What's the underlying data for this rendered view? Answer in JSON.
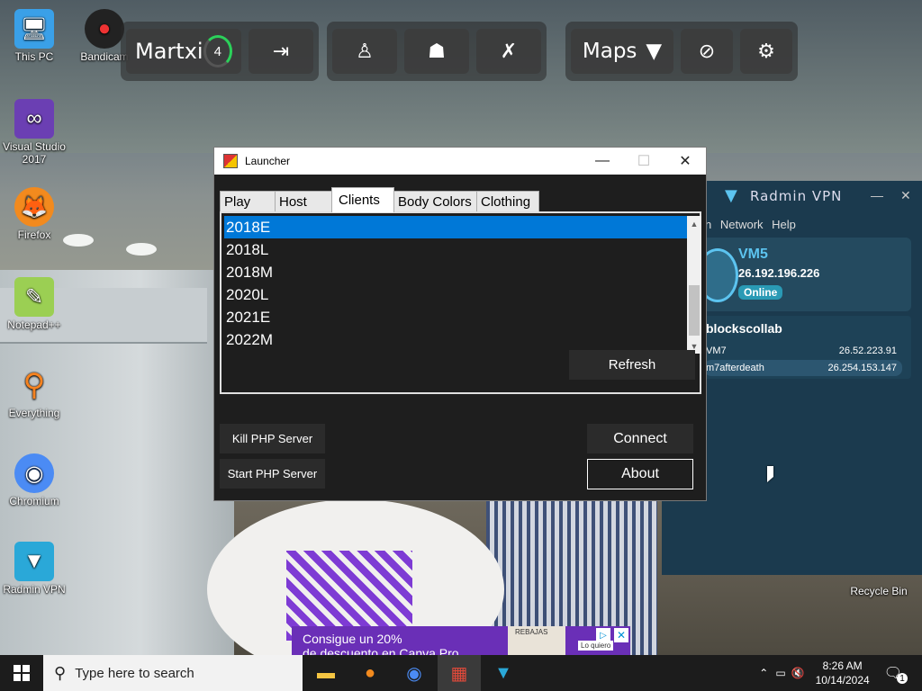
{
  "desktop": {
    "icons": [
      {
        "label": "This PC",
        "icon": "computer-icon"
      },
      {
        "label": "Bandicam",
        "icon": "bandicam-icon"
      },
      {
        "label": "Visual Studio 2017",
        "icon": "visual-studio-icon"
      },
      {
        "label": "Firefox",
        "icon": "firefox-icon"
      },
      {
        "label": "Notepad++",
        "icon": "notepad-plus-icon"
      },
      {
        "label": "Everything",
        "icon": "everything-icon"
      },
      {
        "label": "Chromium",
        "icon": "chromium-icon"
      },
      {
        "label": "Radmin VPN",
        "icon": "radmin-vpn-icon"
      },
      {
        "label": "Recycle Bin",
        "icon": "recycle-bin-icon"
      }
    ]
  },
  "game_toolbar": {
    "username": "Martxi",
    "level": "4",
    "maps_label": "Maps",
    "icons": [
      "logout-icon",
      "character-icon",
      "group-icon",
      "swords-icon",
      "chevron-down-icon",
      "no-timer-icon",
      "gear-icon"
    ]
  },
  "launcher": {
    "title": "Launcher",
    "window_controls": {
      "minimize": "—",
      "maximize": "☐",
      "close": "✕"
    },
    "tabs": [
      "Play",
      "Host",
      "Clients",
      "Body Colors",
      "Clothing"
    ],
    "active_tab": "Clients",
    "clients": [
      "2018E",
      "2018L",
      "2018M",
      "2020L",
      "2021E",
      "2022M"
    ],
    "selected_client": "2018E",
    "refresh_label": "Refresh",
    "kill_php_label": "Kill PHP Server",
    "start_php_label": "Start PHP Server",
    "connect_label": "Connect",
    "about_label": "About"
  },
  "radmin": {
    "brand": "Radmin VPN",
    "menu": "n Network Help",
    "device_name": "VM5",
    "device_ip": "26.192.196.226",
    "device_status": "Online",
    "network_name": "blockscollab",
    "peers": [
      {
        "name": "VM7",
        "ip": "26.52.223.91"
      },
      {
        "name": "m7afterdeath",
        "ip": "26.254.153.147"
      }
    ]
  },
  "ad": {
    "line1": "Consigue un 20%",
    "line2": "de descuento en Canva Pro",
    "brand_small": "REBAJAS",
    "cta": "Lo quiero"
  },
  "taskbar": {
    "search_placeholder": "Type here to search",
    "time": "8:26 AM",
    "date": "10/14/2024",
    "notification_count": "1"
  },
  "colors": {
    "selection_blue": "#0078d7",
    "radmin_bg": "#1b3a4e",
    "radmin_accent": "#5cc4f0",
    "online_badge": "#2a9ab5",
    "level_ring": "#2bd15a"
  }
}
